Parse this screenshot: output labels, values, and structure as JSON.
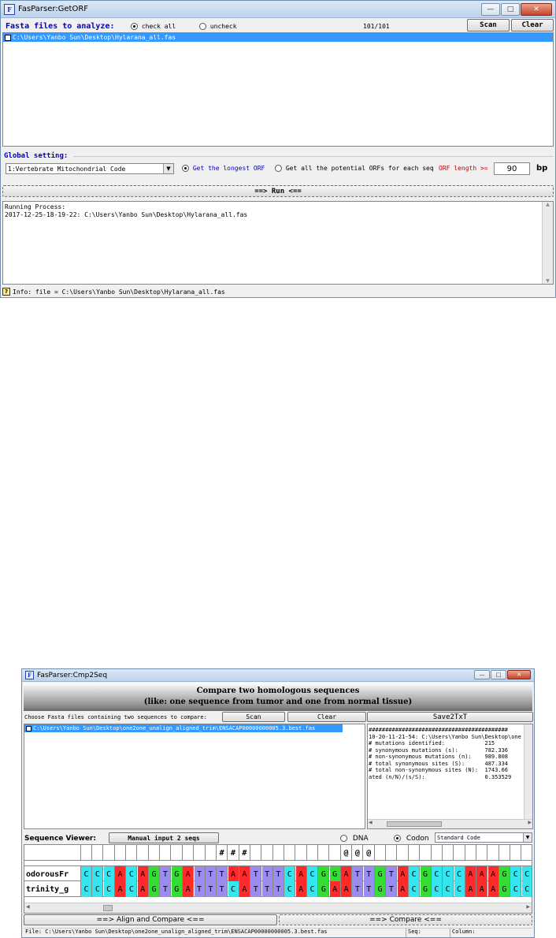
{
  "win1": {
    "title": "FasParser:GetORF",
    "icon": "app-icon",
    "fasta_label": "Fasta files to analyze:",
    "check_all": "check all",
    "uncheck": "uncheck",
    "count": "101/101",
    "scan": "Scan",
    "clear": "Clear",
    "file_item": "C:\\Users\\Yanbo Sun\\Desktop\\Hylarana_all.fas",
    "global_label": "Global setting:",
    "code_select": "1:Vertebrate Mitochondrial Code",
    "opt_longest": "Get the longest ORF",
    "opt_all": "Get all the potential ORFs for each seq",
    "orf_length_label": "ORF length >=",
    "orf_length_value": "90",
    "bp": "bp",
    "run": "==> Run <==",
    "log": "Running Process:\n2017-12-25-18-19-22: C:\\Users\\Yanbo Sun\\Desktop\\Hylarana_all.fas",
    "status": "Info: file = C:\\Users\\Yanbo Sun\\Desktop\\Hylarana_all.fas",
    "colors": {
      "accent": "#0000cc",
      "selection": "#3399ff",
      "orf_label": "#cc0000"
    }
  },
  "win2": {
    "title": "FasParser:Cmp2Seq",
    "banner_line1": "Compare two homologous sequences",
    "banner_line2": "(like: one sequence from tumor and one from normal tissue)",
    "choose_label": "Choose Fasta files containing two sequences to compare:",
    "scan": "Scan",
    "clear": "Clear",
    "save": "Save2TxT",
    "file_item": "C:\\Users\\Yanbo Sun\\Desktop\\one2one_unalign_aligned_trim\\ENSACAP00000000005.3.best.fas",
    "results": "##########################################\n10-20-11-21-54: C:\\Users\\Yanbo Sun\\Desktop\\one\n# mutations identified:            215\n# synonymous mutations (s):        782.336\n# non-synonymous mutations (n):    989.808\n# total synonymous sites (S):      487.334\n# total non-synonymous sites (N):  1743.66\nated (n/N)/(s/S):                  0.353529",
    "viewer_label": "Sequence Viewer:",
    "manual": "Manual input 2 seqs",
    "dna": "DNA",
    "codon": "Codon",
    "code": "Standard Code",
    "seq_names": [
      "odorousFr",
      "trinity_g"
    ],
    "marker_row": [
      "",
      "",
      "",
      "",
      "",
      "",
      "",
      "",
      "",
      "",
      "",
      "",
      "#",
      "#",
      "#",
      "",
      "",
      "",
      "",
      "",
      "",
      "",
      "",
      "@",
      "@",
      "@",
      "",
      "",
      "",
      "",
      "",
      "",
      "",
      "",
      "",
      "",
      "",
      "",
      "",
      "",
      ""
    ],
    "seq1": [
      "C",
      "C",
      "C",
      "A",
      "C",
      "A",
      "G",
      "T",
      "G",
      "A",
      "T",
      "T",
      "T",
      "A",
      "A",
      "T",
      "T",
      "T",
      "C",
      "A",
      "C",
      "G",
      "G",
      "A",
      "T",
      "T",
      "G",
      "T",
      "A",
      "C",
      "G",
      "C",
      "C",
      "C",
      "A",
      "A",
      "A",
      "G",
      "C",
      "C"
    ],
    "seq2": [
      "C",
      "C",
      "C",
      "A",
      "C",
      "A",
      "G",
      "T",
      "G",
      "A",
      "T",
      "T",
      "T",
      "C",
      "A",
      "T",
      "T",
      "T",
      "C",
      "A",
      "C",
      "G",
      "A",
      "A",
      "T",
      "T",
      "G",
      "T",
      "A",
      "C",
      "G",
      "C",
      "C",
      "C",
      "A",
      "A",
      "A",
      "G",
      "C",
      "C"
    ],
    "align": "==> Align and Compare <==",
    "compare": "==> Compare <==",
    "status_file": "File: C:\\Users\\Yanbo Sun\\Desktop\\one2one_unalign_aligned_trim\\ENSACAP00000000005.3.best.fas",
    "status_seq": "Seq:",
    "status_col": "Column:",
    "base_colors": {
      "A": "#ff2a2a",
      "C": "#33e6f0",
      "G": "#33dd33",
      "T": "#9a8cf0"
    }
  }
}
